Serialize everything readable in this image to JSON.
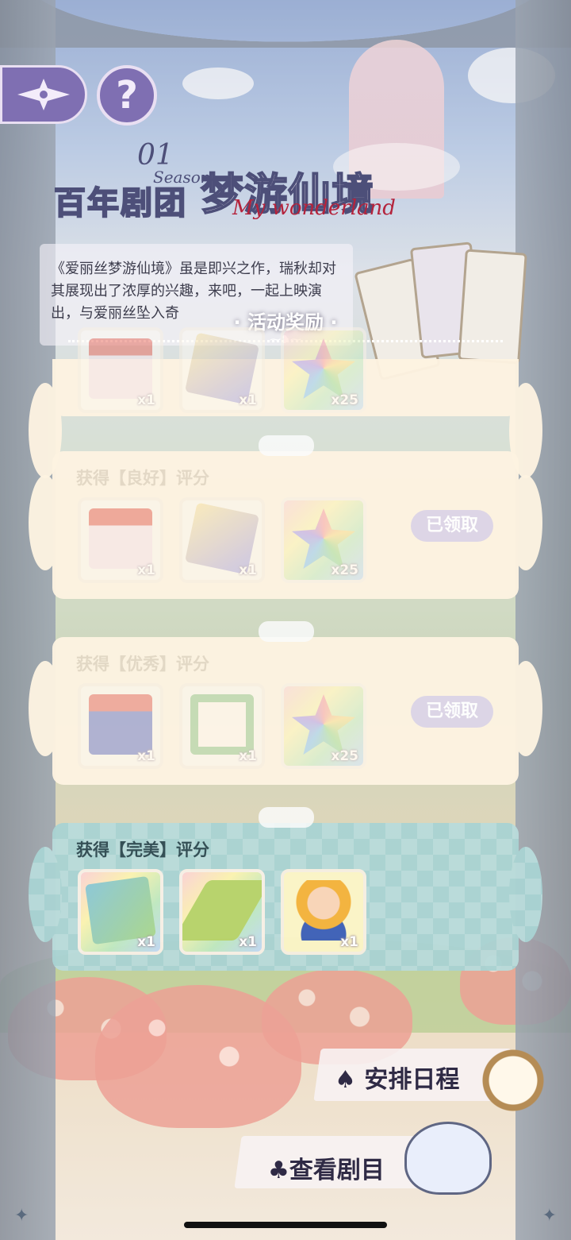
{
  "header": {
    "season_number": "01",
    "season_word": "Season.",
    "troupe_name": "百年剧团",
    "play_title": "梦游仙境",
    "play_title_en": "My wonderland"
  },
  "description": "《爱丽丝梦游仙境》虽是即兴之作，瑞秋却对其展现出了浓厚的兴趣，来吧，一起上映演出，与爱丽丝坠入奇",
  "section_title": "· 活动奖励 ·",
  "rewards": [
    {
      "title": "获得【良好】评分",
      "status": "已领取",
      "items": [
        {
          "icon": "stage-curtain-icon",
          "qty": "x1"
        },
        {
          "icon": "tea-rug-icon",
          "qty": "x1"
        },
        {
          "icon": "rainbow-star-icon",
          "qty": "x25"
        }
      ]
    },
    {
      "title": "获得【优秀】评分",
      "status": "已领取",
      "items": [
        {
          "icon": "night-stage-icon",
          "qty": "x1"
        },
        {
          "icon": "flower-frame-icon",
          "qty": "x1"
        },
        {
          "icon": "rainbow-star-icon",
          "qty": "x25"
        }
      ]
    },
    {
      "title": "获得【完美】评分",
      "status": "",
      "items": [
        {
          "icon": "picture-board-icon",
          "qty": "x1"
        },
        {
          "icon": "grass-floor-icon",
          "qty": "x1"
        },
        {
          "icon": "alice-avatar-icon",
          "qty": "x1"
        }
      ]
    }
  ],
  "partial_top_row": {
    "qty": [
      "x1",
      "x1",
      "x25"
    ]
  },
  "buttons": {
    "schedule": "♠ 安排日程",
    "view_plays": "♣查看剧目"
  },
  "colors": {
    "accent_purple": "#7f6fb2",
    "panel_cream": "#fdf3e1",
    "panel_teal": "#a9d3d3",
    "title_red": "#b4233c"
  }
}
